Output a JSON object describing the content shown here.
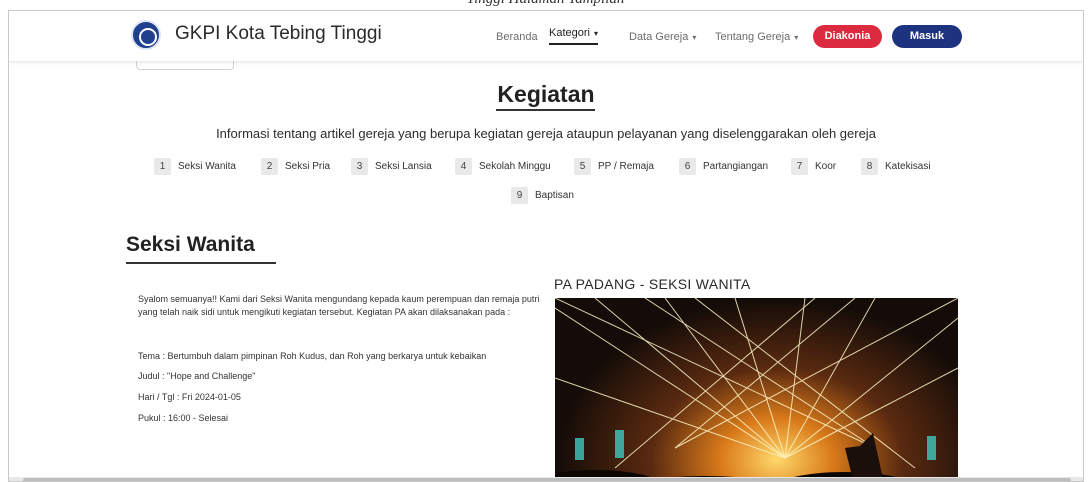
{
  "navbar": {
    "brand": "GKPI Kota Tebing Tinggi",
    "links": [
      {
        "label": "Beranda",
        "dropdown": false,
        "active": false
      },
      {
        "label": "Kategori",
        "dropdown": true,
        "active": true
      },
      {
        "label": "Data Gereja",
        "dropdown": true,
        "active": false
      },
      {
        "label": "Tentang Gereja",
        "dropdown": true,
        "active": false
      }
    ],
    "diakonia_label": "Diakonia",
    "masuk_label": "Masuk",
    "caret": "▾"
  },
  "page": {
    "title": "Kegiatan",
    "description": "Informasi tentang artikel gereja yang berupa kegiatan gereja ataupun pelayanan yang diselenggarakan oleh gereja"
  },
  "categories": [
    {
      "num": "1",
      "label": "Seksi Wanita"
    },
    {
      "num": "2",
      "label": "Seksi Pria"
    },
    {
      "num": "3",
      "label": "Seksi Lansia"
    },
    {
      "num": "4",
      "label": "Sekolah Minggu"
    },
    {
      "num": "5",
      "label": "PP / Remaja"
    },
    {
      "num": "6",
      "label": "Partangiangan"
    },
    {
      "num": "7",
      "label": "Koor"
    },
    {
      "num": "8",
      "label": "Katekisasi"
    },
    {
      "num": "9",
      "label": "Baptisan"
    }
  ],
  "section": {
    "title": "Seksi Wanita",
    "body": "Syalom semuanya!! Kami dari Seksi Wanita mengundang kepada kaum perempuan dan remaja putri yang telah naik sidi untuk mengikuti kegiatan tersebut. Kegiatan PA akan dilaksanakan pada :",
    "tema": "Tema : Bertumbuh dalam pimpinan Roh Kudus, dan Roh yang berkarya untuk kebaikan",
    "judul": "Judul : \"Hope and Challenge\"",
    "hari": "Hari / Tgl : Fri 2024-01-05",
    "pukul": "Pukul : 16:00 - Selesai"
  },
  "article": {
    "title": "PA PADANG - SEKSI WANITA"
  },
  "colors": {
    "diakonia": "#dc2b3e",
    "masuk": "#1d3380",
    "category_badge": "#e9e9e9"
  }
}
